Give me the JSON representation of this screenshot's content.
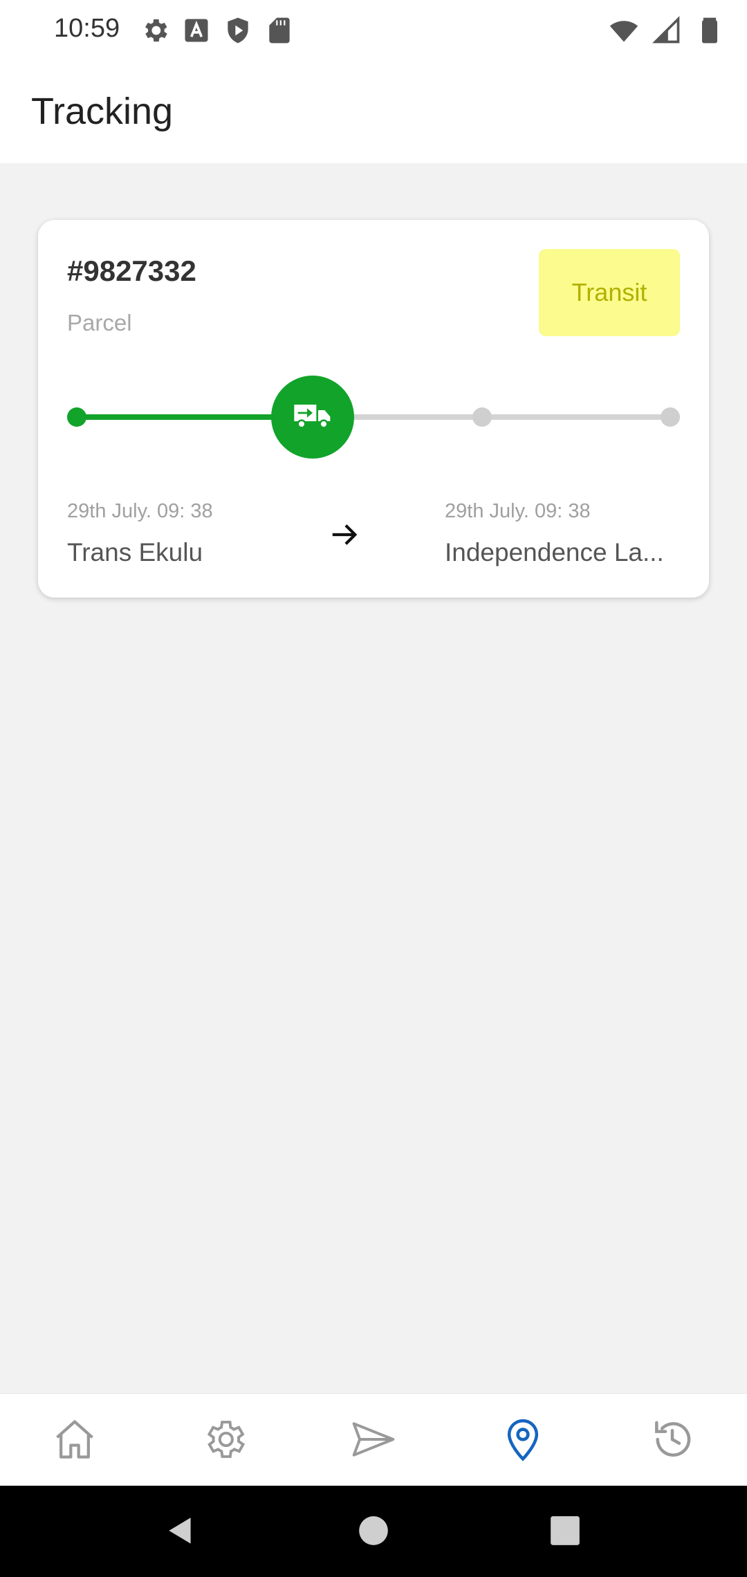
{
  "status_bar": {
    "time": "10:59",
    "left_icons": [
      "gear-icon",
      "font-a-icon",
      "shield-play-icon",
      "sd-card-icon"
    ],
    "right_icons": [
      "wifi-icon",
      "signal-icon",
      "battery-icon"
    ]
  },
  "header": {
    "title": "Tracking"
  },
  "shipment": {
    "id": "#9827332",
    "type": "Parcel",
    "status": "Transit",
    "status_color": "#fbfb8e",
    "accent_color": "#12a32a",
    "progress_steps_total": 4,
    "progress_current_step": 2,
    "origin": {
      "time": "29th July. 09: 38",
      "place": "Trans Ekulu"
    },
    "destination": {
      "time": "29th July. 09: 38",
      "place": "Independence La..."
    }
  },
  "bottom_nav": {
    "items": [
      {
        "icon": "home-icon",
        "active": false
      },
      {
        "icon": "settings-icon",
        "active": false
      },
      {
        "icon": "send-icon",
        "active": false
      },
      {
        "icon": "location-pin-icon",
        "active": true
      },
      {
        "icon": "history-icon",
        "active": false
      }
    ],
    "active_color": "#1565c0"
  },
  "system_nav": {
    "buttons": [
      "back-icon",
      "home-circle-icon",
      "recents-icon"
    ]
  }
}
